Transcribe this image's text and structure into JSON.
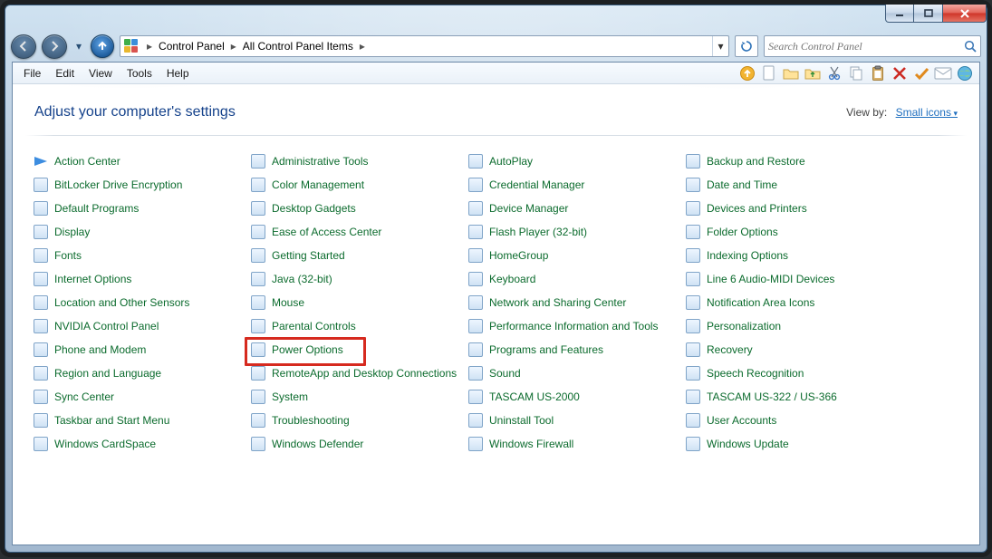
{
  "title_buttons": {
    "min": "–",
    "max": "☐",
    "close": "✕"
  },
  "breadcrumb": {
    "seg1": "Control Panel",
    "seg2": "All Control Panel Items"
  },
  "search": {
    "placeholder": "Search Control Panel"
  },
  "menu": {
    "file": "File",
    "edit": "Edit",
    "view": "View",
    "tools": "Tools",
    "help": "Help"
  },
  "header": {
    "title": "Adjust your computer's settings",
    "viewby_label": "View by:",
    "viewby_value": "Small icons"
  },
  "highlighted_item": "Power Options",
  "columns": [
    [
      "Action Center",
      "BitLocker Drive Encryption",
      "Default Programs",
      "Display",
      "Fonts",
      "Internet Options",
      "Location and Other Sensors",
      "NVIDIA Control Panel",
      "Phone and Modem",
      "Region and Language",
      "Sync Center",
      "Taskbar and Start Menu",
      "Windows CardSpace"
    ],
    [
      "Administrative Tools",
      "Color Management",
      "Desktop Gadgets",
      "Ease of Access Center",
      "Getting Started",
      "Java (32-bit)",
      "Mouse",
      "Parental Controls",
      "Power Options",
      "RemoteApp and Desktop Connections",
      "System",
      "Troubleshooting",
      "Windows Defender"
    ],
    [
      "AutoPlay",
      "Credential Manager",
      "Device Manager",
      "Flash Player (32-bit)",
      "HomeGroup",
      "Keyboard",
      "Network and Sharing Center",
      "Performance Information and Tools",
      "Programs and Features",
      "Sound",
      "TASCAM US-2000",
      "Uninstall Tool",
      "Windows Firewall"
    ],
    [
      "Backup and Restore",
      "Date and Time",
      "Devices and Printers",
      "Folder Options",
      "Indexing Options",
      "Line 6 Audio-MIDI Devices",
      "Notification Area Icons",
      "Personalization",
      "Recovery",
      "Speech Recognition",
      "TASCAM US-322 / US-366",
      "User Accounts",
      "Windows Update"
    ]
  ]
}
